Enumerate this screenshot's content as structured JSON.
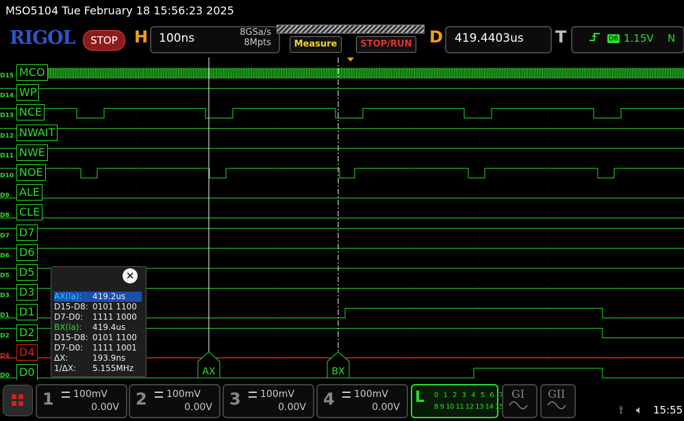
{
  "titlebar": {
    "text": "MSO5104  Tue February 18 15:56:23 2025"
  },
  "toolbar": {
    "brand": "RIGOL",
    "stop_label": "STOP",
    "h_letter": "H",
    "timebase": "100ns",
    "sample_rate": "8GSa/s",
    "memory_depth": "8Mpts",
    "measure_label": "Measure",
    "stoprun_label": "STOP/RUN",
    "d_letter": "D",
    "delay": "419.4403us",
    "t_letter": "T",
    "trigger_edge_icon": "rising-edge-icon",
    "trigger_source": "D6",
    "trigger_level": "1.15V",
    "trigger_mode": "N"
  },
  "channels": [
    {
      "tag": "D15",
      "label": "MCO"
    },
    {
      "tag": "D14",
      "label": "WP"
    },
    {
      "tag": "D13",
      "label": "NCE"
    },
    {
      "tag": "D12",
      "label": "NWAIT"
    },
    {
      "tag": "D11",
      "label": "NWE"
    },
    {
      "tag": "D10",
      "label": "NOE"
    },
    {
      "tag": "D9",
      "label": "ALE"
    },
    {
      "tag": "D8",
      "label": "CLE"
    },
    {
      "tag": "D7",
      "label": "D7"
    },
    {
      "tag": "D6",
      "label": "D6"
    },
    {
      "tag": "D5",
      "label": "D5"
    },
    {
      "tag": "D3",
      "label": "D3"
    },
    {
      "tag": "D1",
      "label": "D1"
    },
    {
      "tag": "D2",
      "label": "D2"
    },
    {
      "tag": "D4",
      "label": "D4"
    },
    {
      "tag": "D0",
      "label": "D0"
    }
  ],
  "cursors": {
    "ax_label": "AX",
    "bx_label": "BX",
    "panel": {
      "ax_key": "AX(la):",
      "ax_val": "419.2us",
      "ax_hi_key": "D15-D8:",
      "ax_hi_val": "0101 1100",
      "ax_lo_key": "D7-D0:",
      "ax_lo_val": "1111 1000",
      "bx_key": "BX(la):",
      "bx_val": "419.4us",
      "bx_hi_key": "D15-D8:",
      "bx_hi_val": "0101 1100",
      "bx_lo_key": "D7-D0:",
      "bx_lo_val": "1111 1001",
      "dx_key": "ΔX:",
      "dx_val": "193.9ns",
      "inv_key": "1/ΔX:",
      "inv_val": "5.155MHz"
    }
  },
  "bottom": {
    "ch1": {
      "num": "1",
      "scale": "100mV",
      "offset": "0.00V"
    },
    "ch2": {
      "num": "2",
      "scale": "100mV",
      "offset": "0.00V"
    },
    "ch3": {
      "num": "3",
      "scale": "100mV",
      "offset": "0.00V"
    },
    "ch4": {
      "num": "4",
      "scale": "100mV",
      "offset": "0.00V"
    },
    "la_letter": "L",
    "la_row1": "0 1 2 3 4 5 6 7",
    "la_row2": "8 9 10 11 12 13 14 15",
    "g1": "GI",
    "g2": "GII",
    "usb_icon": "usb-icon",
    "speaker_icon": "speaker-muted-icon",
    "clock": "15:55"
  },
  "colors": {
    "trace": "#28e028",
    "d4_trace": "#e02020",
    "ax_cursor": "#1fd6ff",
    "brand": "#2f55c8",
    "accent": "#f39c1e"
  }
}
